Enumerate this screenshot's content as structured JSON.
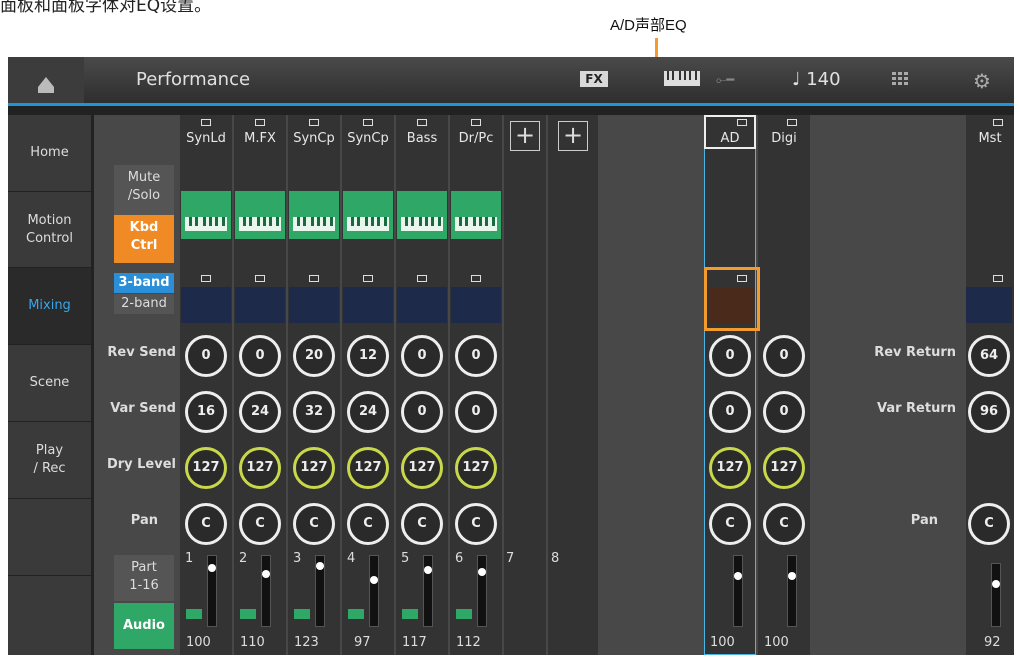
{
  "caption": {
    "top_text": "面板和面板字体对EQ设置。",
    "callout": "A/D声部EQ"
  },
  "header": {
    "title": "Performance",
    "fx": "FX",
    "tempo": "♩ 140"
  },
  "sidebar": {
    "tabs": [
      {
        "label": "Home"
      },
      {
        "label": "Motion\nControl"
      },
      {
        "label": "Mixing"
      },
      {
        "label": "Scene"
      },
      {
        "label": "Play\n/ Rec"
      }
    ]
  },
  "parts": {
    "names": [
      "SynLd",
      "M.FX",
      "SynCp",
      "SynCp",
      "Bass",
      "Dr/Pc"
    ],
    "numbers": [
      "1",
      "2",
      "3",
      "4",
      "5",
      "6",
      "7",
      "8"
    ],
    "rev_send": [
      "0",
      "0",
      "20",
      "12",
      "0",
      "0"
    ],
    "var_send": [
      "16",
      "24",
      "32",
      "24",
      "0",
      "0"
    ],
    "dry_level": [
      "127",
      "127",
      "127",
      "127",
      "127",
      "127"
    ],
    "pan": [
      "C",
      "C",
      "C",
      "C",
      "C",
      "C"
    ],
    "volume": [
      "100",
      "110",
      "123",
      "97",
      "117",
      "112"
    ]
  },
  "audio": {
    "ad_name": "AD",
    "digi_name": "Digi",
    "rev_send": [
      "0",
      "0"
    ],
    "var_send": [
      "0",
      "0"
    ],
    "dry_level": [
      "127",
      "127"
    ],
    "pan": [
      "C",
      "C"
    ],
    "volume": [
      "100",
      "100"
    ]
  },
  "master": {
    "name": "Mst",
    "rev_return": "64",
    "var_return": "96",
    "pan": "C",
    "volume": "92"
  },
  "labels": {
    "mute_solo": "Mute\n/Solo",
    "kbd_ctrl": "Kbd\nCtrl",
    "band3": "3-band",
    "band2": "2-band",
    "rev_send": "Rev Send",
    "var_send": "Var Send",
    "dry_level": "Dry Level",
    "pan": "Pan",
    "rev_return": "Rev Return",
    "var_return": "Var Return",
    "master_pan": "Pan",
    "part_range": "Part\n1-16",
    "audio_btn": "Audio"
  },
  "colors": {
    "accent": "#1d95d8",
    "callout": "#f39c2c",
    "kbd": "#2fa766",
    "active_orange": "#f08a24",
    "dry": "#c9d84a"
  }
}
